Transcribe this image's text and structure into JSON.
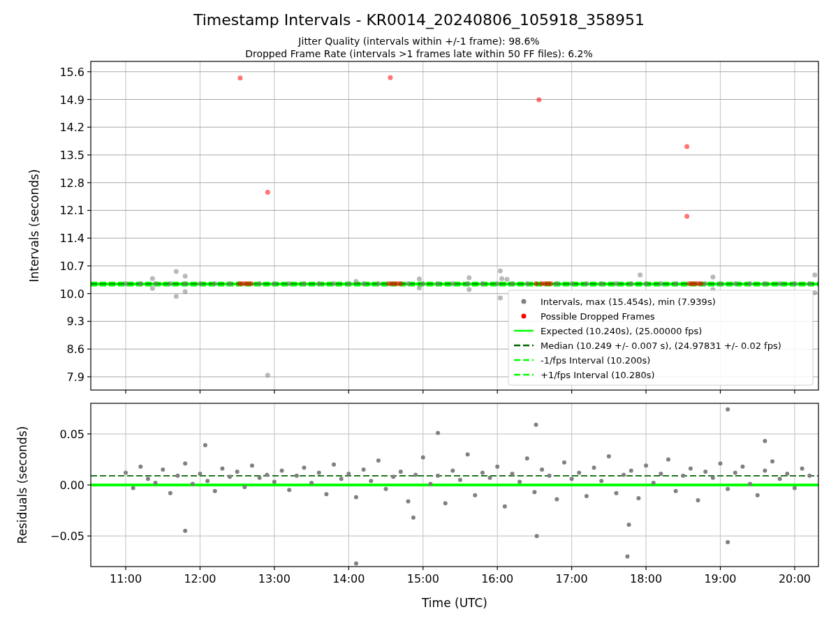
{
  "figure": {
    "title": "Timestamp Intervals - KR0014_20240806_105918_358951"
  },
  "charts": [
    {
      "subtitles": [
        "Jitter Quality (intervals within +/-1 frame): 98.6%",
        "Dropped Frame Rate (intervals >1 frames late within 50 FF files): 6.2%"
      ],
      "chart_data": {
        "type": "scatter",
        "ylabel": "Intervals (seconds)",
        "xlim": [
          10.53,
          20.32
        ],
        "ylim": [
          7.565,
          15.86
        ],
        "yticks": [
          {
            "value": 7.9,
            "label": "7.9"
          },
          {
            "value": 8.6,
            "label": "8.6"
          },
          {
            "value": 9.3,
            "label": "9.3"
          },
          {
            "value": 10.0,
            "label": "10.0"
          },
          {
            "value": 10.7,
            "label": "10.7"
          },
          {
            "value": 11.4,
            "label": "11.4"
          },
          {
            "value": 12.1,
            "label": "12.1"
          },
          {
            "value": 12.8,
            "label": "12.8"
          },
          {
            "value": 13.5,
            "label": "13.5"
          },
          {
            "value": 14.2,
            "label": "14.2"
          },
          {
            "value": 14.9,
            "label": "14.9"
          },
          {
            "value": 15.6,
            "label": "15.6"
          }
        ],
        "series": [
          {
            "name": "Intervals, max (15.454s), min (7.939s)",
            "type": "scatter",
            "color": "#808080",
            "x": [
              11,
              11.2,
              11.4,
              11.6,
              11.8,
              12,
              12.2,
              12.4,
              12.8,
              13,
              13.2,
              13.4,
              13.6,
              13.8,
              14,
              14.2,
              14.4,
              14.8,
              15,
              15.2,
              15.4,
              15.6,
              15.8,
              16,
              16.2,
              16.4,
              16.8,
              17,
              17.2,
              17.4,
              17.6,
              17.8,
              18,
              18.2,
              18.4,
              18.8,
              19,
              19.2,
              19.4,
              19.6,
              19.8,
              20,
              20.2,
              11.36,
              11.36,
              11.68,
              11.68,
              11.8,
              11.8,
              12.91,
              14.1,
              14.95,
              14.95,
              15.62,
              15.62,
              16.04,
              16.04,
              16.06,
              16.13,
              17.92,
              18.9,
              18.9,
              20.27,
              20.27
            ],
            "values": [
              10.25,
              10.25,
              10.25,
              10.25,
              10.25,
              10.25,
              10.25,
              10.25,
              10.25,
              10.25,
              10.25,
              10.25,
              10.25,
              10.25,
              10.25,
              10.25,
              10.25,
              10.25,
              10.25,
              10.25,
              10.25,
              10.25,
              10.25,
              10.25,
              10.25,
              10.25,
              10.25,
              10.25,
              10.25,
              10.25,
              10.25,
              10.25,
              10.25,
              10.25,
              10.25,
              10.25,
              10.25,
              10.25,
              10.25,
              10.25,
              10.25,
              10.25,
              10.25,
              10.38,
              10.13,
              10.56,
              9.93,
              10.44,
              10.05,
              7.94,
              10.31,
              10.37,
              10.14,
              10.4,
              10.1,
              10.57,
              9.89,
              10.38,
              10.36,
              10.47,
              10.42,
              10.1,
              10.47,
              10.02
            ]
          },
          {
            "name": "Possible Dropped Frames",
            "type": "scatter",
            "color": "#ff0000",
            "x": [
              12.54,
              12.91,
              14.56,
              16.56,
              18.55,
              18.55,
              12.53,
              12.57,
              12.61,
              12.65,
              12.69,
              14.54,
              14.58,
              14.62,
              14.66,
              14.7,
              16.52,
              16.6,
              16.64,
              16.68,
              16.72,
              18.58,
              18.62,
              18.66,
              18.7,
              18.74
            ],
            "values": [
              15.44,
              12.56,
              15.45,
              14.89,
              13.71,
              11.95,
              10.25,
              10.25,
              10.25,
              10.25,
              10.25,
              10.25,
              10.25,
              10.25,
              10.25,
              10.25,
              10.25,
              10.25,
              10.25,
              10.25,
              10.25,
              10.25,
              10.25,
              10.25,
              10.25,
              10.25
            ]
          },
          {
            "name": "Expected (10.240s), (25.00000 fps)",
            "type": "line",
            "line_style": "solid",
            "color": "#00ff00",
            "x": [
              10.53,
              20.32
            ],
            "values": [
              10.24,
              10.24
            ]
          },
          {
            "name": "Median (10.249 +/- 0.007 s), (24.97831 +/- 0.02 fps)",
            "type": "line",
            "line_style": "dashed",
            "color": "#006400",
            "x": [
              10.53,
              20.32
            ],
            "values": [
              10.249,
              10.249
            ]
          },
          {
            "name": "-1/fps Interval (10.200s)",
            "type": "line",
            "line_style": "dashed",
            "color": "#00ff00",
            "x": [
              10.53,
              20.32
            ],
            "values": [
              10.2,
              10.2
            ]
          },
          {
            "name": "+1/fps Interval (10.280s)",
            "type": "line",
            "line_style": "dashed",
            "color": "#00ff00",
            "x": [
              10.53,
              20.32
            ],
            "values": [
              10.28,
              10.28
            ]
          }
        ],
        "grid": true,
        "legend": true
      }
    },
    {
      "chart_data": {
        "type": "scatter",
        "xlabel": "Time (UTC)",
        "ylabel": "Residuals (seconds)",
        "xlim": [
          10.53,
          20.32
        ],
        "ylim": [
          -0.08,
          0.08
        ],
        "xticks": [
          {
            "value": 11,
            "label": "11:00"
          },
          {
            "value": 12,
            "label": "12:00"
          },
          {
            "value": 13,
            "label": "13:00"
          },
          {
            "value": 14,
            "label": "14:00"
          },
          {
            "value": 15,
            "label": "15:00"
          },
          {
            "value": 16,
            "label": "16:00"
          },
          {
            "value": 17,
            "label": "17:00"
          },
          {
            "value": 18,
            "label": "18:00"
          },
          {
            "value": 19,
            "label": "19:00"
          },
          {
            "value": 20,
            "label": "20:00"
          }
        ],
        "yticks": [
          {
            "value": -0.05,
            "label": "−0.05"
          },
          {
            "value": 0,
            "label": "0.00"
          },
          {
            "value": 0.05,
            "label": "0.05"
          }
        ],
        "series": [
          {
            "type": "scatter",
            "color": "#808080",
            "x": [
              11,
              11.1,
              11.2,
              11.3,
              11.4,
              11.5,
              11.6,
              11.7,
              11.8,
              11.9,
              12,
              12.1,
              12.2,
              12.3,
              12.4,
              12.5,
              12.6,
              12.7,
              12.8,
              12.9,
              13,
              13.1,
              13.2,
              13.3,
              13.4,
              13.5,
              13.6,
              13.7,
              13.8,
              13.9,
              14,
              14.1,
              14.2,
              14.3,
              14.4,
              14.5,
              14.6,
              14.7,
              14.8,
              14.9,
              15,
              15.1,
              15.2,
              15.3,
              15.4,
              15.5,
              15.6,
              15.7,
              15.8,
              15.9,
              16,
              16.1,
              16.2,
              16.3,
              16.4,
              16.5,
              16.6,
              16.7,
              16.8,
              16.9,
              17,
              17.1,
              17.2,
              17.3,
              17.4,
              17.5,
              17.6,
              17.7,
              17.8,
              17.9,
              18,
              18.1,
              18.2,
              18.3,
              18.4,
              18.5,
              18.6,
              18.7,
              18.8,
              18.9,
              19,
              19.1,
              19.2,
              19.3,
              19.4,
              19.5,
              19.6,
              19.7,
              19.8,
              19.9,
              20,
              20.1,
              20.2,
              11.8,
              12.07,
              14.1,
              14.87,
              15.2,
              16.52,
              16.53,
              17.75,
              17.77,
              19.1,
              19.1,
              19.6
            ],
            "values": [
              0.012,
              -0.003,
              0.018,
              0.006,
              0.002,
              0.015,
              -0.008,
              0.009,
              0.021,
              0.001,
              0.011,
              0.004,
              -0.006,
              0.016,
              0.008,
              0.013,
              -0.002,
              0.019,
              0.007,
              0.01,
              0.003,
              0.014,
              -0.005,
              0.009,
              0.017,
              0.002,
              0.012,
              -0.009,
              0.02,
              0.006,
              0.011,
              -0.012,
              0.015,
              0.004,
              0.024,
              -0.004,
              0.008,
              0.013,
              -0.016,
              0.01,
              0.027,
              0.001,
              0.009,
              -0.018,
              0.014,
              0.005,
              0.03,
              -0.01,
              0.012,
              0.007,
              0.018,
              -0.021,
              0.011,
              0.003,
              0.026,
              -0.007,
              0.015,
              0.009,
              -0.014,
              0.022,
              0.006,
              0.012,
              -0.011,
              0.017,
              0.004,
              0.028,
              -0.008,
              0.01,
              0.014,
              -0.013,
              0.019,
              0.002,
              0.011,
              0.025,
              -0.006,
              0.009,
              0.016,
              -0.015,
              0.013,
              0.007,
              0.021,
              -0.004,
              0.012,
              0.018,
              0.001,
              -0.01,
              0.014,
              0.023,
              0.006,
              0.011,
              -0.003,
              0.016,
              0.009,
              -0.045,
              0.039,
              -0.077,
              -0.032,
              0.051,
              0.059,
              -0.05,
              -0.07,
              -0.039,
              0.074,
              -0.056,
              0.043
            ]
          },
          {
            "type": "line",
            "line_style": "solid",
            "color": "#00ff00",
            "x": [
              10.53,
              20.32
            ],
            "values": [
              0,
              0
            ]
          },
          {
            "type": "line",
            "line_style": "dashed",
            "color": "#006400",
            "x": [
              10.53,
              20.32
            ],
            "values": [
              0.009,
              0.009
            ]
          }
        ],
        "grid": true
      }
    }
  ]
}
